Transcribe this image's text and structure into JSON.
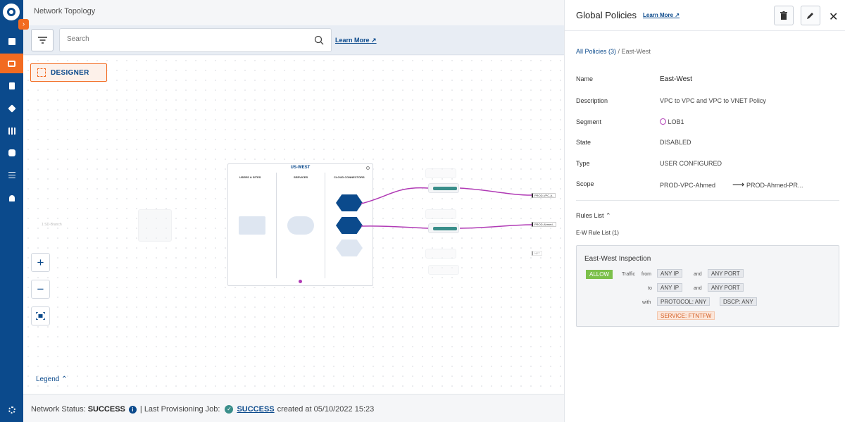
{
  "sidebar": {
    "expand_glyph": "›",
    "items": [
      {
        "icon": "dashboard-icon"
      },
      {
        "icon": "topology-icon",
        "active": true
      },
      {
        "icon": "document-icon"
      },
      {
        "icon": "network-icon"
      },
      {
        "icon": "apps-grid-icon"
      },
      {
        "icon": "puzzle-icon"
      },
      {
        "icon": "sliders-icon"
      },
      {
        "icon": "bell-icon"
      }
    ],
    "bottom_icon": "settings-gear-icon"
  },
  "header": {
    "title": "Network Topology"
  },
  "toolbar": {
    "search_placeholder": "Search",
    "learn_more": "Learn More"
  },
  "canvas": {
    "designer_label": "DESIGNER",
    "zoom_in": "+",
    "zoom_out": "−",
    "legend_label": "Legend",
    "region": {
      "title": "US-WEST",
      "columns": [
        "USERS & SITES",
        "SERVICES",
        "CLOUD CONNECTORS"
      ]
    },
    "connection_tags": [
      "PROD-VPC-A..",
      "PROD-Ahmed..",
      "NET"
    ],
    "faded_label": "1 SD-Branch"
  },
  "status": {
    "network_status_label": "Network Status:",
    "network_status_value": "SUCCESS",
    "separator": "|",
    "last_job_label": "Last Provisioning Job:",
    "last_job_value": "SUCCESS",
    "created_at": "created at 05/10/2022 15:23"
  },
  "panel": {
    "title": "Global Policies",
    "learn_more": "Learn More",
    "breadcrumb_link": "All Policies (3)",
    "breadcrumb_current": "/ East-West",
    "fields": {
      "name_label": "Name",
      "name_value": "East-West",
      "description_label": "Description",
      "description_value": "VPC to VPC and VPC to VNET Policy",
      "segment_label": "Segment",
      "segment_value": "LOB1",
      "state_label": "State",
      "state_value": "DISABLED",
      "type_label": "Type",
      "type_value": "USER CONFIGURED",
      "scope_label": "Scope",
      "scope_from": "PROD-VPC-Ahmed",
      "scope_to": "PROD-Ahmed-PR..."
    },
    "rules_list_label": "Rules List",
    "ew_rule_list_label": "E-W Rule List (1)",
    "rule": {
      "name": "East-West Inspection",
      "action": "ALLOW",
      "traffic_label": "Traffic",
      "from_label": "from",
      "from_ip": "ANY IP",
      "and_label_1": "and",
      "from_port": "ANY PORT",
      "to_label": "to",
      "to_ip": "ANY IP",
      "and_label_2": "and",
      "to_port": "ANY PORT",
      "with_label": "with",
      "protocol": "PROTOCOL: ANY",
      "dscp": "DSCP: ANY",
      "service": "SERVICE: FTNTFW"
    }
  },
  "colors": {
    "sidebar_bg": "#0b4a8c",
    "accent_orange": "#f26b21",
    "allow_green": "#7cc04b",
    "link_purple": "#b03ab5",
    "connector_teal": "#3a8e8a"
  }
}
